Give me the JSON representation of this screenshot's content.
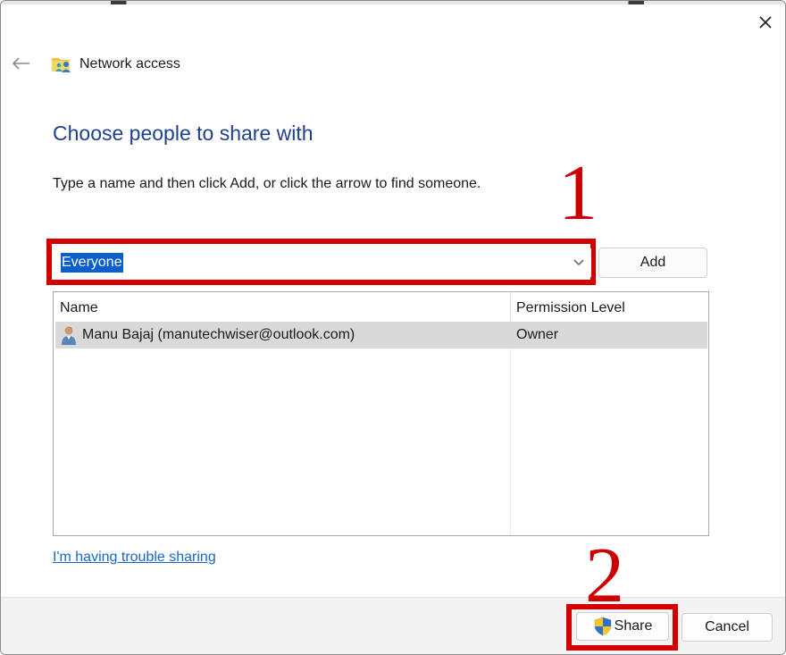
{
  "window": {
    "title": "Network access",
    "title_icon": "network-folder-icon",
    "back_icon": "arrow-left-icon",
    "close_icon": "close-icon"
  },
  "main": {
    "heading": "Choose people to share with",
    "instruction": "Type a name and then click Add, or click the arrow to find someone.",
    "name_combo": {
      "value": "Everyone",
      "arrow_icon": "chevron-down-icon"
    },
    "add_label": "Add",
    "list": {
      "columns": [
        "Name",
        "Permission Level"
      ],
      "rows": [
        {
          "name": "Manu Bajaj (manutechwiser@outlook.com)",
          "permission": "Owner",
          "icon": "user-icon"
        }
      ]
    },
    "trouble_link": "I'm having trouble sharing"
  },
  "footer": {
    "share_label": "Share",
    "share_icon": "uac-shield-icon",
    "cancel_label": "Cancel"
  },
  "annotations": {
    "step_1": "1",
    "step_2": "2",
    "highlight_color": "#d40000"
  },
  "colors": {
    "heading": "#1f3f8f",
    "link": "#1a66c7",
    "selection": "#0a5fcc"
  }
}
